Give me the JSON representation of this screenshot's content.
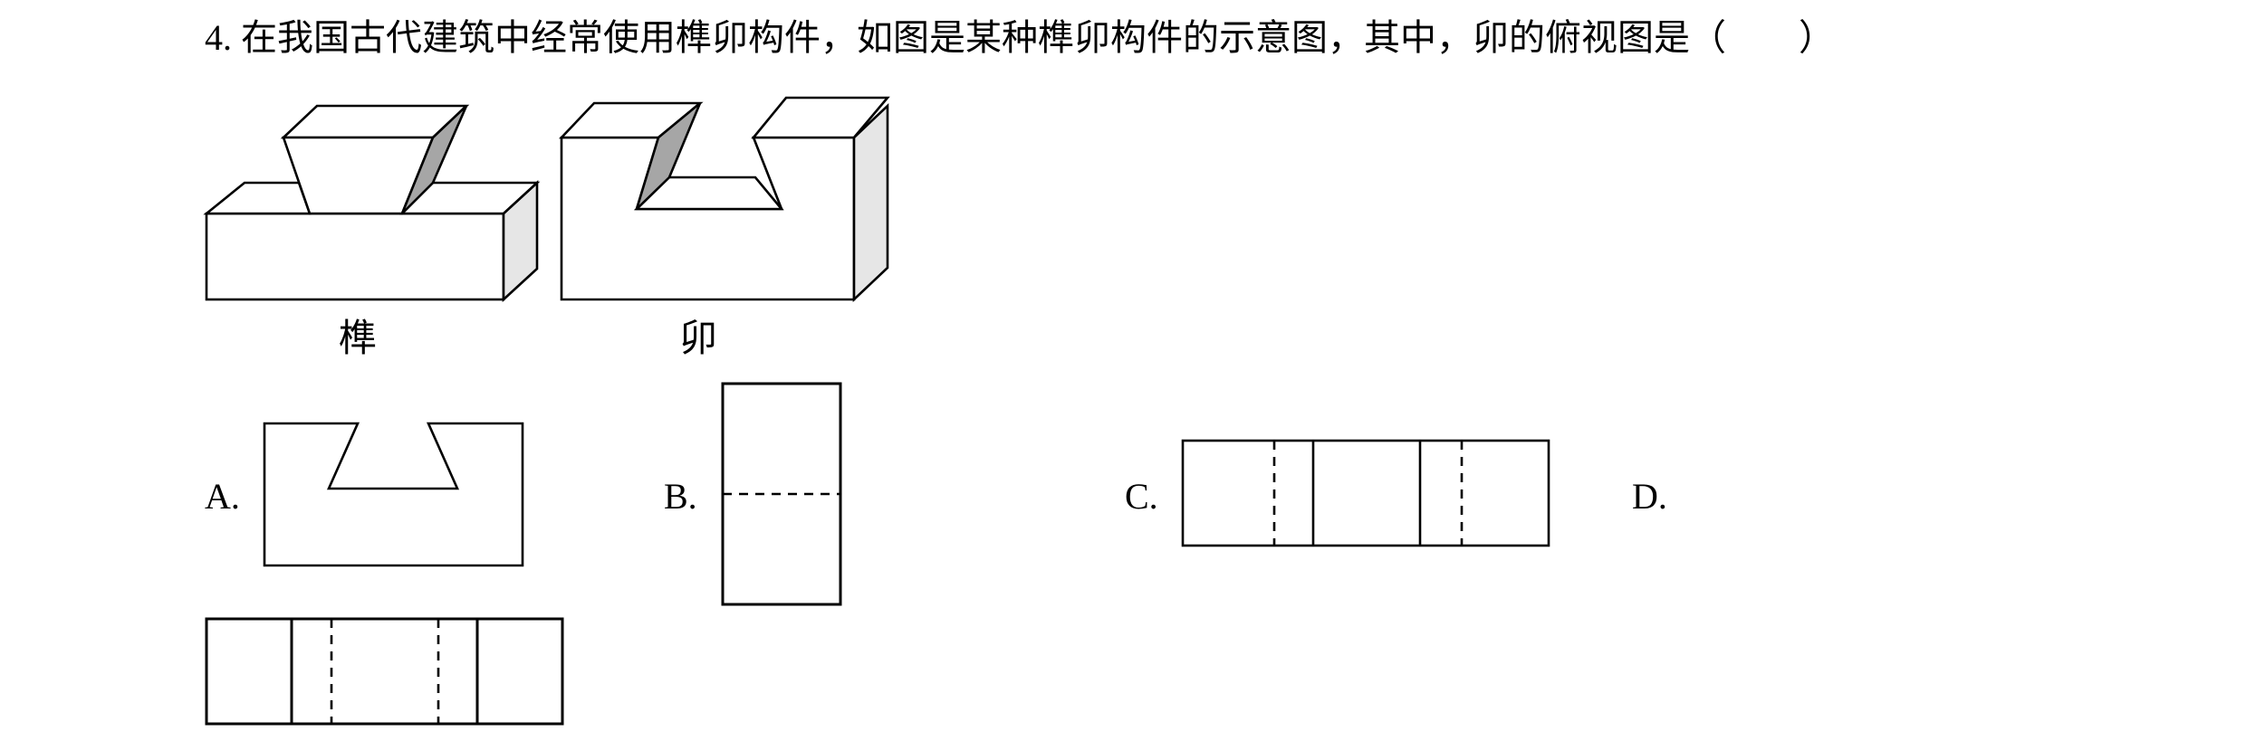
{
  "question": {
    "number": "4.",
    "text": "在我国古代建筑中经常使用榫卯构件，如图是某种榫卯构件的示意图，其中，卯的俯视图是（　　）"
  },
  "figure": {
    "tenon_caption": "榫",
    "mortise_caption": "卯"
  },
  "options": {
    "a_label": "A.",
    "b_label": "B.",
    "c_label": "C.",
    "d_label": "D."
  },
  "colors": {
    "line": "#000000",
    "shade_dark": "#a6a6a6",
    "shade_light": "#e6e6e6",
    "background": "#ffffff"
  }
}
